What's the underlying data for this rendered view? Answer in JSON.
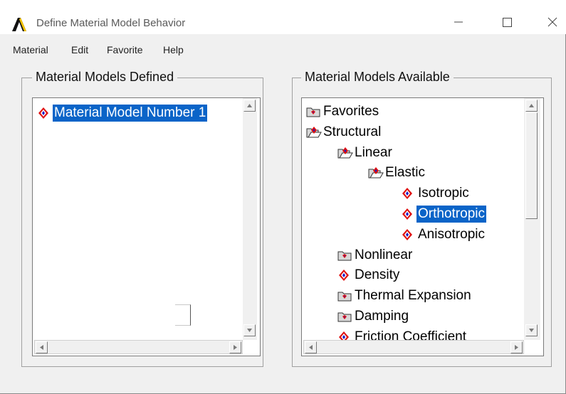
{
  "window": {
    "title": "Define Material Model Behavior",
    "controls": {
      "minimize": "—",
      "maximize": "☐",
      "close": "✕"
    }
  },
  "menu": {
    "items": [
      "Material",
      "Edit",
      "Favorite",
      "Help"
    ]
  },
  "defined_panel": {
    "title": "Material Models Defined",
    "items": [
      {
        "label": "Material Model Number 1",
        "icon": "material-model-icon",
        "selected": true
      }
    ]
  },
  "available_panel": {
    "title": "Material Models Available",
    "items": [
      {
        "label": "Favorites",
        "icon": "folder-closed-icon"
      },
      {
        "label": "Structural",
        "icon": "folder-open-icon"
      },
      {
        "label": "Linear",
        "icon": "folder-open-icon"
      },
      {
        "label": "Elastic",
        "icon": "folder-open-icon"
      },
      {
        "label": "Isotropic",
        "icon": "material-model-icon"
      },
      {
        "label": "Orthotropic",
        "icon": "material-model-icon",
        "selected": true
      },
      {
        "label": "Anisotropic",
        "icon": "material-model-icon"
      },
      {
        "label": "Nonlinear",
        "icon": "folder-closed-icon"
      },
      {
        "label": "Density",
        "icon": "material-model-icon"
      },
      {
        "label": "Thermal Expansion",
        "icon": "folder-closed-icon"
      },
      {
        "label": "Damping",
        "icon": "folder-closed-icon"
      },
      {
        "label": "Friction Coefficient",
        "icon": "material-model-icon"
      }
    ]
  },
  "colors": {
    "selection": "#0a64c8",
    "icon_red": "#e01010",
    "icon_blue": "#1818c8"
  }
}
